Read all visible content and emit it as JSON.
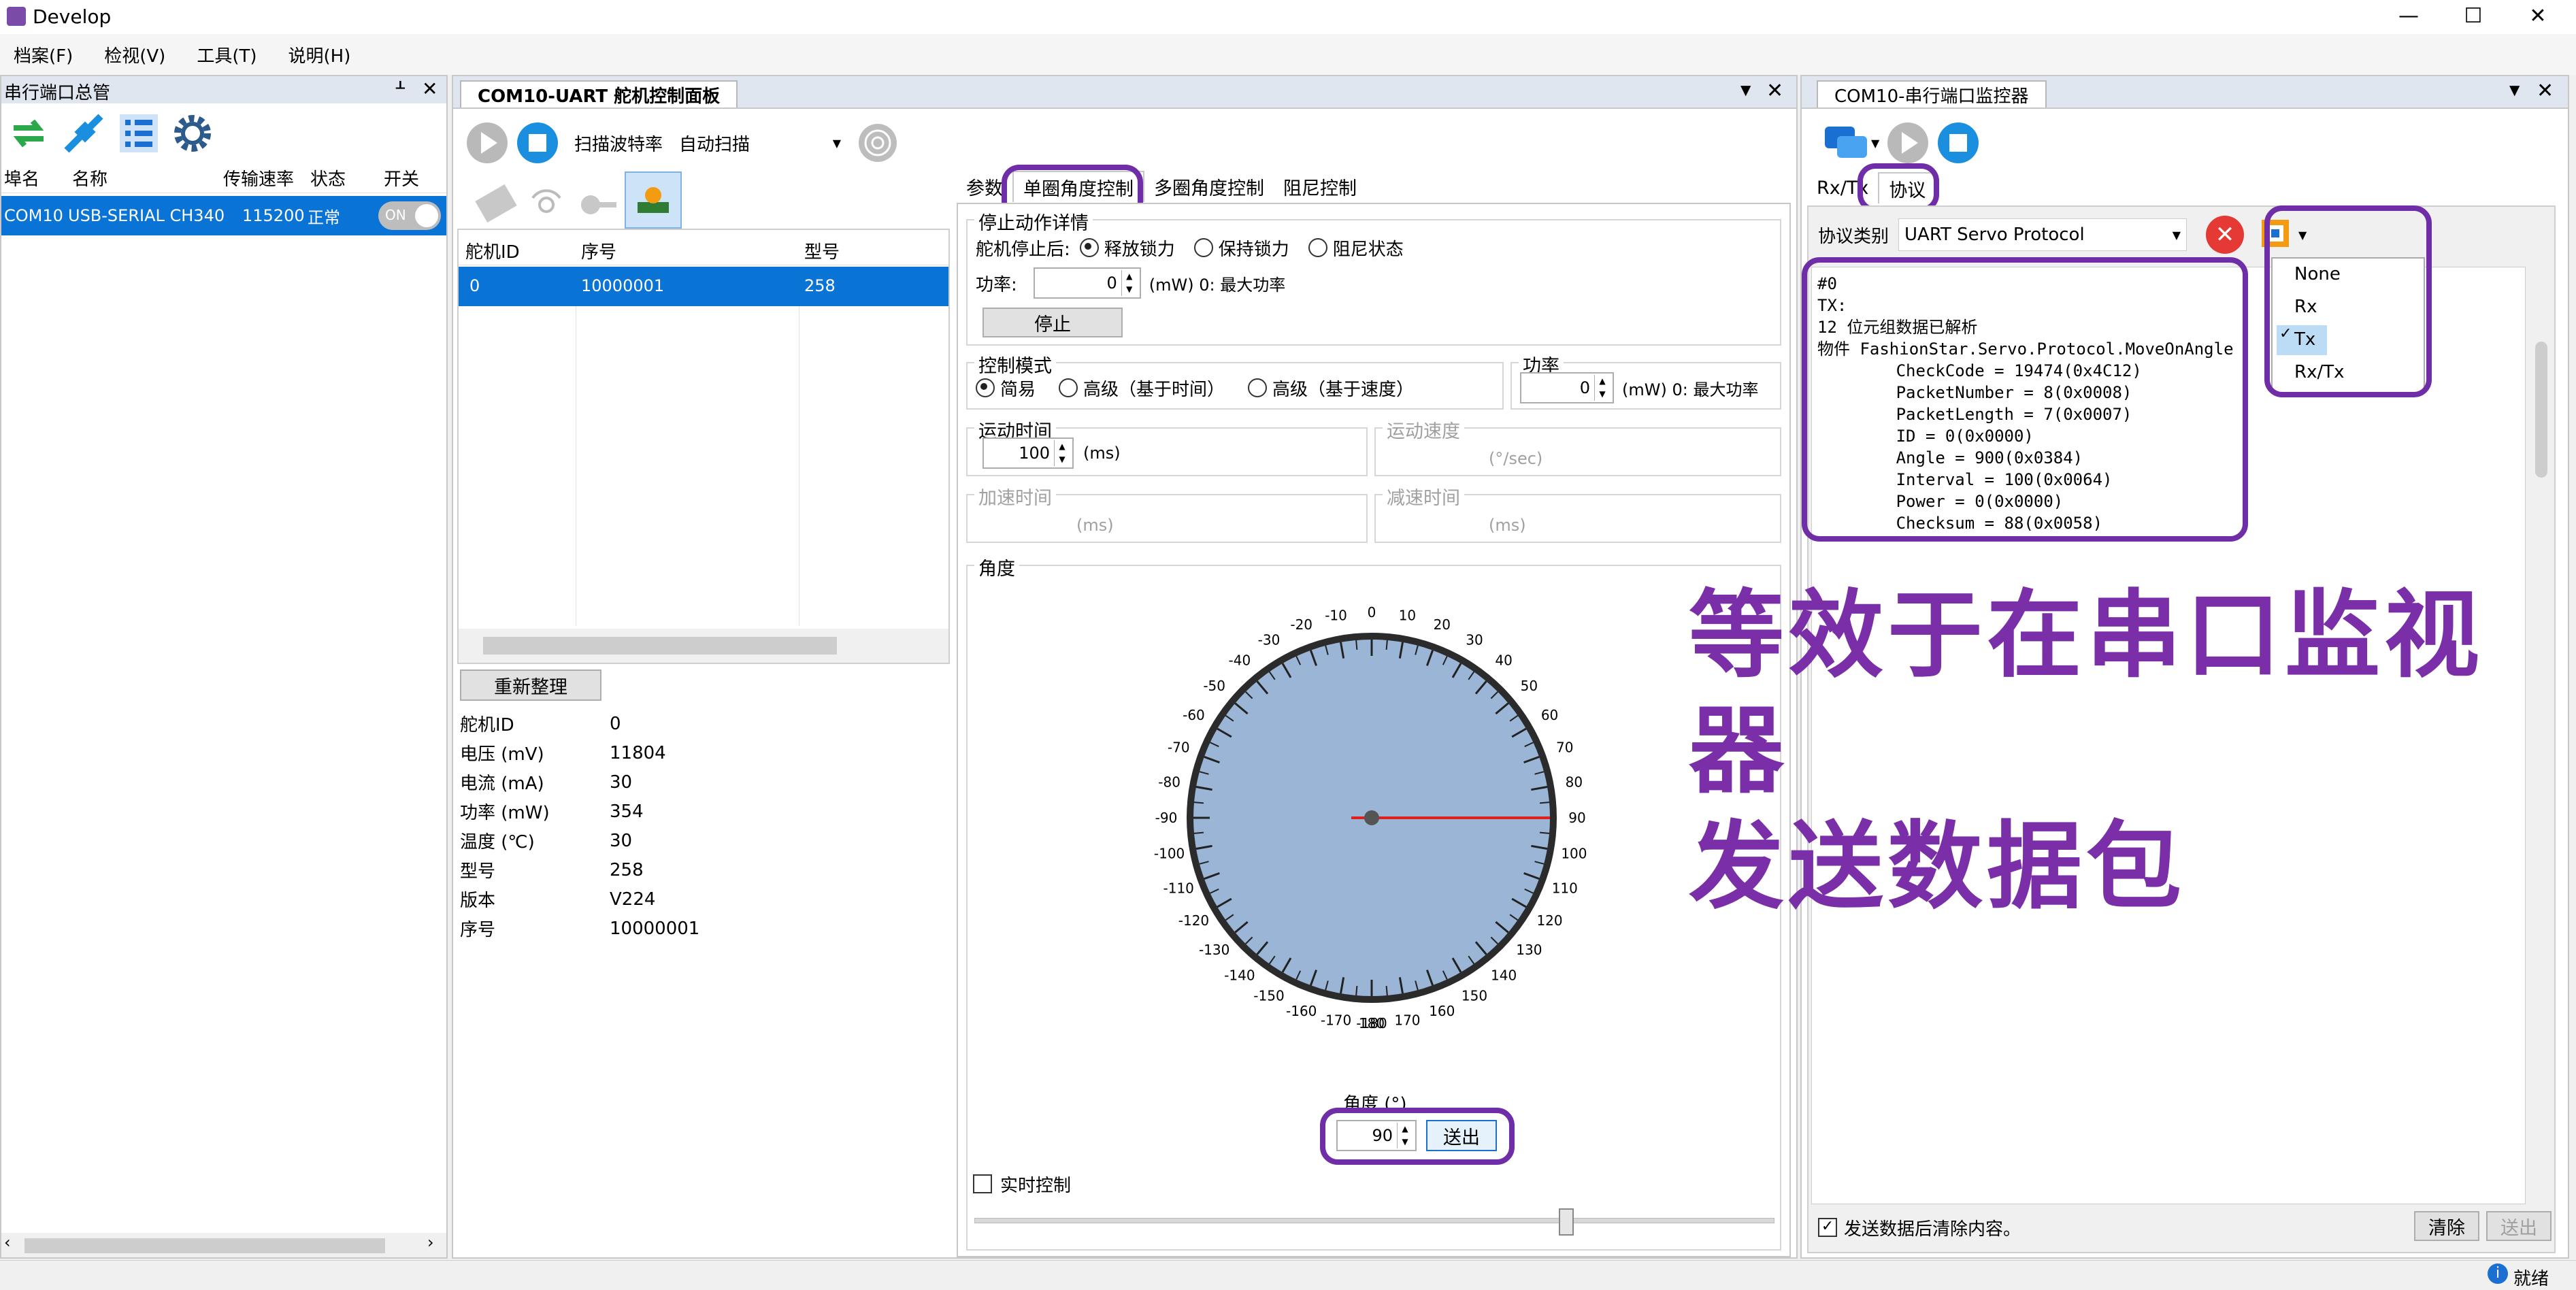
{
  "window": {
    "title": "Develop",
    "minimize": "—",
    "maximize": "☐",
    "close": "✕"
  },
  "menu": [
    "档案(F)",
    "检视(V)",
    "工具(T)",
    "说明(H)"
  ],
  "left_panel": {
    "title": "串行端口总管",
    "pin": "ᚆ",
    "close": "✕",
    "columns": [
      "埠名",
      "名称",
      "传输速率",
      "状态",
      "开关"
    ],
    "rows": [
      {
        "port": "COM10",
        "name": "USB-SERIAL CH340",
        "baud": "115200",
        "status": "正常",
        "switch": "ON"
      }
    ]
  },
  "middle_panel": {
    "tab_title": "COM10-UART 舵机控制面板",
    "scan_label": "扫描波特率",
    "scan_value": "自动扫描",
    "servo_columns": [
      "舵机ID",
      "序号",
      "型号"
    ],
    "servo_rows": [
      {
        "id": "0",
        "serial": "10000001",
        "model": "258"
      }
    ],
    "refresh_button": "重新整理",
    "info": [
      {
        "label": "舵机ID",
        "value": "0"
      },
      {
        "label": "电压 (mV)",
        "value": "11804"
      },
      {
        "label": "电流 (mA)",
        "value": "30"
      },
      {
        "label": "功率 (mW)",
        "value": "354"
      },
      {
        "label": "温度 (℃)",
        "value": "30"
      },
      {
        "label": "型号",
        "value": "258"
      },
      {
        "label": "版本",
        "value": "V224"
      },
      {
        "label": "序号",
        "value": "10000001"
      }
    ],
    "tabs": [
      "参数",
      "单圈角度控制",
      "多圈角度控制",
      "阻尼控制"
    ],
    "stop_group": {
      "title": "停止动作详情",
      "after_stop_label": "舵机停止后:",
      "options": [
        "释放锁力",
        "保持锁力",
        "阻尼状态"
      ],
      "power_label": "功率:",
      "power_value": "0",
      "power_unit": "(mW) 0: 最大功率",
      "stop_button": "停止"
    },
    "control_mode": {
      "title": "控制模式",
      "options": [
        "简易",
        "高级（基于时间）",
        "高级（基于速度）"
      ]
    },
    "power_group": {
      "title": "功率",
      "value": "0",
      "unit": "(mW) 0: 最大功率"
    },
    "move_time": {
      "title": "运动时间",
      "value": "100",
      "unit": "(ms)"
    },
    "move_speed": {
      "title": "运动速度",
      "unit": "(°/sec)"
    },
    "accel_time": {
      "title": "加速时间",
      "unit": "(ms)"
    },
    "decel_time": {
      "title": "减速时间",
      "unit": "(ms)"
    },
    "angle_group": {
      "title": "角度",
      "dial_labels": [
        "-180",
        "-170",
        "-160",
        "-150",
        "-140",
        "-130",
        "-120",
        "-110",
        "-100",
        "-90",
        "-80",
        "-70",
        "-60",
        "-50",
        "-40",
        "-30",
        "-20",
        "-10",
        "0",
        "10",
        "20",
        "30",
        "40",
        "50",
        "60",
        "70",
        "80",
        "90",
        "100",
        "110",
        "120",
        "130",
        "140",
        "150",
        "160",
        "170",
        "180"
      ],
      "current_angle": 90,
      "angle_label": "角度 (°)",
      "angle_value": "90",
      "send_button": "送出",
      "realtime_label": "实时控制",
      "slider_fraction": 0.74
    }
  },
  "right_panel": {
    "tab_title": "COM10-串行端口监控器",
    "tabs": [
      "Rx/Tx",
      "协议"
    ],
    "protocol_label": "协议类别",
    "protocol_value": "UART Servo Protocol",
    "output": "#0\nTX:\n12 位元组数据已解析\n物件 FashionStar.Servo.Protocol.MoveOnAngle\n        CheckCode = 19474(0x4C12)\n        PacketNumber = 8(0x0008)\n        PacketLength = 7(0x0007)\n        ID = 0(0x0000)\n        Angle = 900(0x0384)\n        Interval = 100(0x0064)\n        Power = 0(0x0000)\n        Checksum = 88(0x0058)",
    "dropdown": [
      "None",
      "Rx",
      "Tx",
      "Rx/Tx"
    ],
    "dropdown_selected": "Tx",
    "clear_after_send": "发送数据后清除内容。",
    "clear_button": "清除",
    "send_button": "送出"
  },
  "annotation": {
    "line1": "等效于在串口监视器",
    "line2": "发送数据包"
  },
  "statusbar": {
    "text": "就绪"
  },
  "colors": {
    "accent": "#6f2da8",
    "selection": "#0a73d6",
    "dial": "#9ab5d6",
    "needle": "#e0201c"
  }
}
